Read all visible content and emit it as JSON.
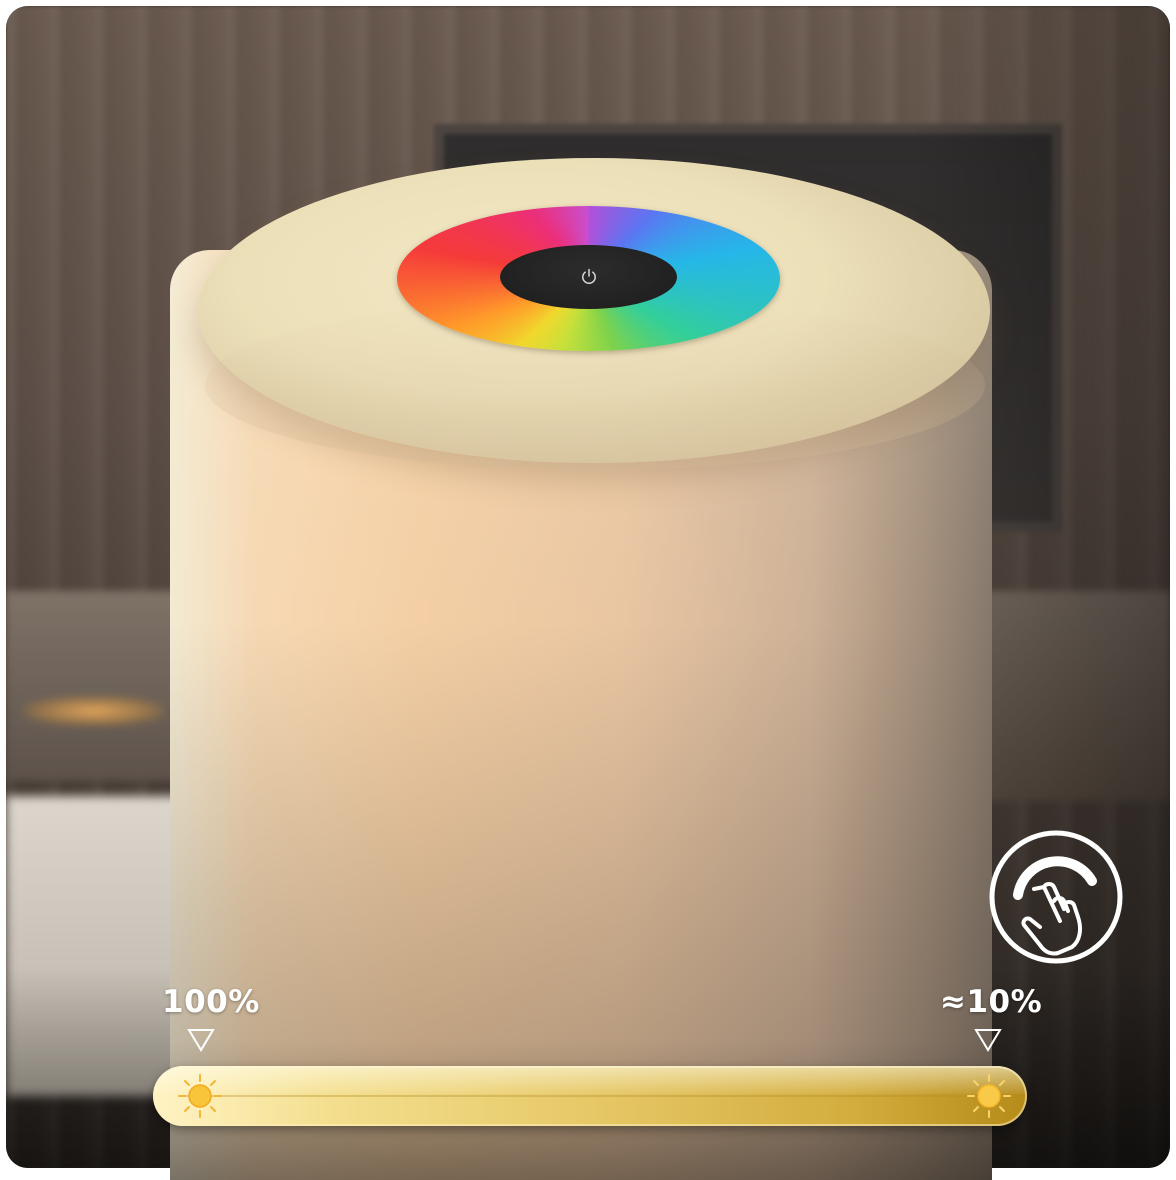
{
  "brightness": {
    "max_label": "100%",
    "min_label": "≈10%",
    "max_value_percent": 100,
    "min_value_percent": 10
  },
  "icons": {
    "power": "power-icon",
    "touch_dim": "touch-dimming-hand-icon",
    "sun": "sun-icon",
    "marker": "triangle-down-marker-icon"
  },
  "colors": {
    "bar_light": "#fff3c4",
    "bar_dark": "#b58b19",
    "sun": "#f7c43a",
    "lamp_shade": "#f4cfa5",
    "power_button": "#1c1c1c"
  }
}
